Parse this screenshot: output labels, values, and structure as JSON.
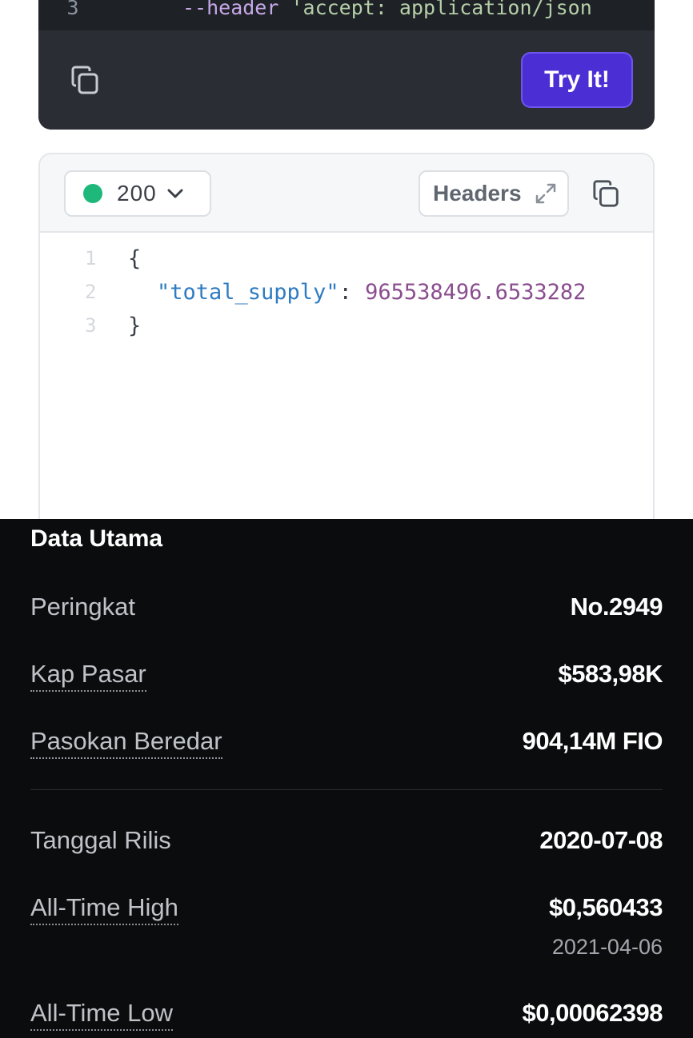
{
  "request": {
    "line_number": "3",
    "line_flag": "--header",
    "line_value": " 'accept: application/json",
    "try_label": "Try It!",
    "copy_icon": "copy-icon"
  },
  "response": {
    "status_code": "200",
    "status_color": "#1db87a",
    "headers_label": "Headers",
    "json_lines": [
      {
        "num": "1",
        "text": "{"
      },
      {
        "num": "2",
        "key": "\"total_supply\"",
        "sep": ": ",
        "value": "965538496.6533282"
      },
      {
        "num": "3",
        "text": "}"
      }
    ]
  },
  "data_utama": {
    "title": "Data Utama",
    "rows": [
      {
        "label": "Peringkat",
        "value": "No.2949"
      },
      {
        "label": "Kap Pasar",
        "value": "$583,98K"
      },
      {
        "label": "Pasokan Beredar",
        "value": "904,14M FIO"
      },
      {
        "label": "Tanggal Rilis",
        "value": "2020-07-08"
      },
      {
        "label": "All-Time High",
        "value": "$0,560433",
        "sub": "2021-04-06"
      },
      {
        "label": "All-Time Low",
        "value": "$0,00062398"
      }
    ]
  },
  "colors": {
    "accent": "#4c2fd4",
    "dark_bg": "#0b0c0d",
    "code_bg": "#2a2d33"
  }
}
